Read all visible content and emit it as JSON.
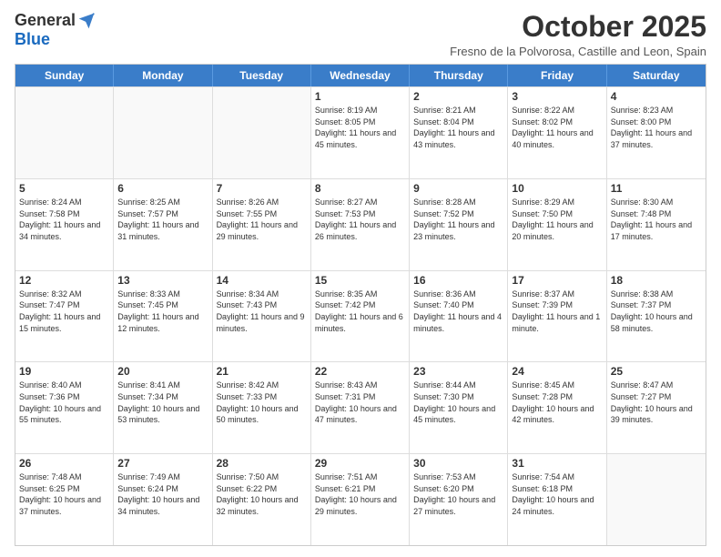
{
  "logo": {
    "general": "General",
    "blue": "Blue"
  },
  "title": "October 2025",
  "location": "Fresno de la Polvorosa, Castille and Leon, Spain",
  "days": [
    "Sunday",
    "Monday",
    "Tuesday",
    "Wednesday",
    "Thursday",
    "Friday",
    "Saturday"
  ],
  "weeks": [
    [
      {
        "day": "",
        "text": ""
      },
      {
        "day": "",
        "text": ""
      },
      {
        "day": "",
        "text": ""
      },
      {
        "day": "1",
        "text": "Sunrise: 8:19 AM\nSunset: 8:05 PM\nDaylight: 11 hours and 45 minutes."
      },
      {
        "day": "2",
        "text": "Sunrise: 8:21 AM\nSunset: 8:04 PM\nDaylight: 11 hours and 43 minutes."
      },
      {
        "day": "3",
        "text": "Sunrise: 8:22 AM\nSunset: 8:02 PM\nDaylight: 11 hours and 40 minutes."
      },
      {
        "day": "4",
        "text": "Sunrise: 8:23 AM\nSunset: 8:00 PM\nDaylight: 11 hours and 37 minutes."
      }
    ],
    [
      {
        "day": "5",
        "text": "Sunrise: 8:24 AM\nSunset: 7:58 PM\nDaylight: 11 hours and 34 minutes."
      },
      {
        "day": "6",
        "text": "Sunrise: 8:25 AM\nSunset: 7:57 PM\nDaylight: 11 hours and 31 minutes."
      },
      {
        "day": "7",
        "text": "Sunrise: 8:26 AM\nSunset: 7:55 PM\nDaylight: 11 hours and 29 minutes."
      },
      {
        "day": "8",
        "text": "Sunrise: 8:27 AM\nSunset: 7:53 PM\nDaylight: 11 hours and 26 minutes."
      },
      {
        "day": "9",
        "text": "Sunrise: 8:28 AM\nSunset: 7:52 PM\nDaylight: 11 hours and 23 minutes."
      },
      {
        "day": "10",
        "text": "Sunrise: 8:29 AM\nSunset: 7:50 PM\nDaylight: 11 hours and 20 minutes."
      },
      {
        "day": "11",
        "text": "Sunrise: 8:30 AM\nSunset: 7:48 PM\nDaylight: 11 hours and 17 minutes."
      }
    ],
    [
      {
        "day": "12",
        "text": "Sunrise: 8:32 AM\nSunset: 7:47 PM\nDaylight: 11 hours and 15 minutes."
      },
      {
        "day": "13",
        "text": "Sunrise: 8:33 AM\nSunset: 7:45 PM\nDaylight: 11 hours and 12 minutes."
      },
      {
        "day": "14",
        "text": "Sunrise: 8:34 AM\nSunset: 7:43 PM\nDaylight: 11 hours and 9 minutes."
      },
      {
        "day": "15",
        "text": "Sunrise: 8:35 AM\nSunset: 7:42 PM\nDaylight: 11 hours and 6 minutes."
      },
      {
        "day": "16",
        "text": "Sunrise: 8:36 AM\nSunset: 7:40 PM\nDaylight: 11 hours and 4 minutes."
      },
      {
        "day": "17",
        "text": "Sunrise: 8:37 AM\nSunset: 7:39 PM\nDaylight: 11 hours and 1 minute."
      },
      {
        "day": "18",
        "text": "Sunrise: 8:38 AM\nSunset: 7:37 PM\nDaylight: 10 hours and 58 minutes."
      }
    ],
    [
      {
        "day": "19",
        "text": "Sunrise: 8:40 AM\nSunset: 7:36 PM\nDaylight: 10 hours and 55 minutes."
      },
      {
        "day": "20",
        "text": "Sunrise: 8:41 AM\nSunset: 7:34 PM\nDaylight: 10 hours and 53 minutes."
      },
      {
        "day": "21",
        "text": "Sunrise: 8:42 AM\nSunset: 7:33 PM\nDaylight: 10 hours and 50 minutes."
      },
      {
        "day": "22",
        "text": "Sunrise: 8:43 AM\nSunset: 7:31 PM\nDaylight: 10 hours and 47 minutes."
      },
      {
        "day": "23",
        "text": "Sunrise: 8:44 AM\nSunset: 7:30 PM\nDaylight: 10 hours and 45 minutes."
      },
      {
        "day": "24",
        "text": "Sunrise: 8:45 AM\nSunset: 7:28 PM\nDaylight: 10 hours and 42 minutes."
      },
      {
        "day": "25",
        "text": "Sunrise: 8:47 AM\nSunset: 7:27 PM\nDaylight: 10 hours and 39 minutes."
      }
    ],
    [
      {
        "day": "26",
        "text": "Sunrise: 7:48 AM\nSunset: 6:25 PM\nDaylight: 10 hours and 37 minutes."
      },
      {
        "day": "27",
        "text": "Sunrise: 7:49 AM\nSunset: 6:24 PM\nDaylight: 10 hours and 34 minutes."
      },
      {
        "day": "28",
        "text": "Sunrise: 7:50 AM\nSunset: 6:22 PM\nDaylight: 10 hours and 32 minutes."
      },
      {
        "day": "29",
        "text": "Sunrise: 7:51 AM\nSunset: 6:21 PM\nDaylight: 10 hours and 29 minutes."
      },
      {
        "day": "30",
        "text": "Sunrise: 7:53 AM\nSunset: 6:20 PM\nDaylight: 10 hours and 27 minutes."
      },
      {
        "day": "31",
        "text": "Sunrise: 7:54 AM\nSunset: 6:18 PM\nDaylight: 10 hours and 24 minutes."
      },
      {
        "day": "",
        "text": ""
      }
    ]
  ]
}
